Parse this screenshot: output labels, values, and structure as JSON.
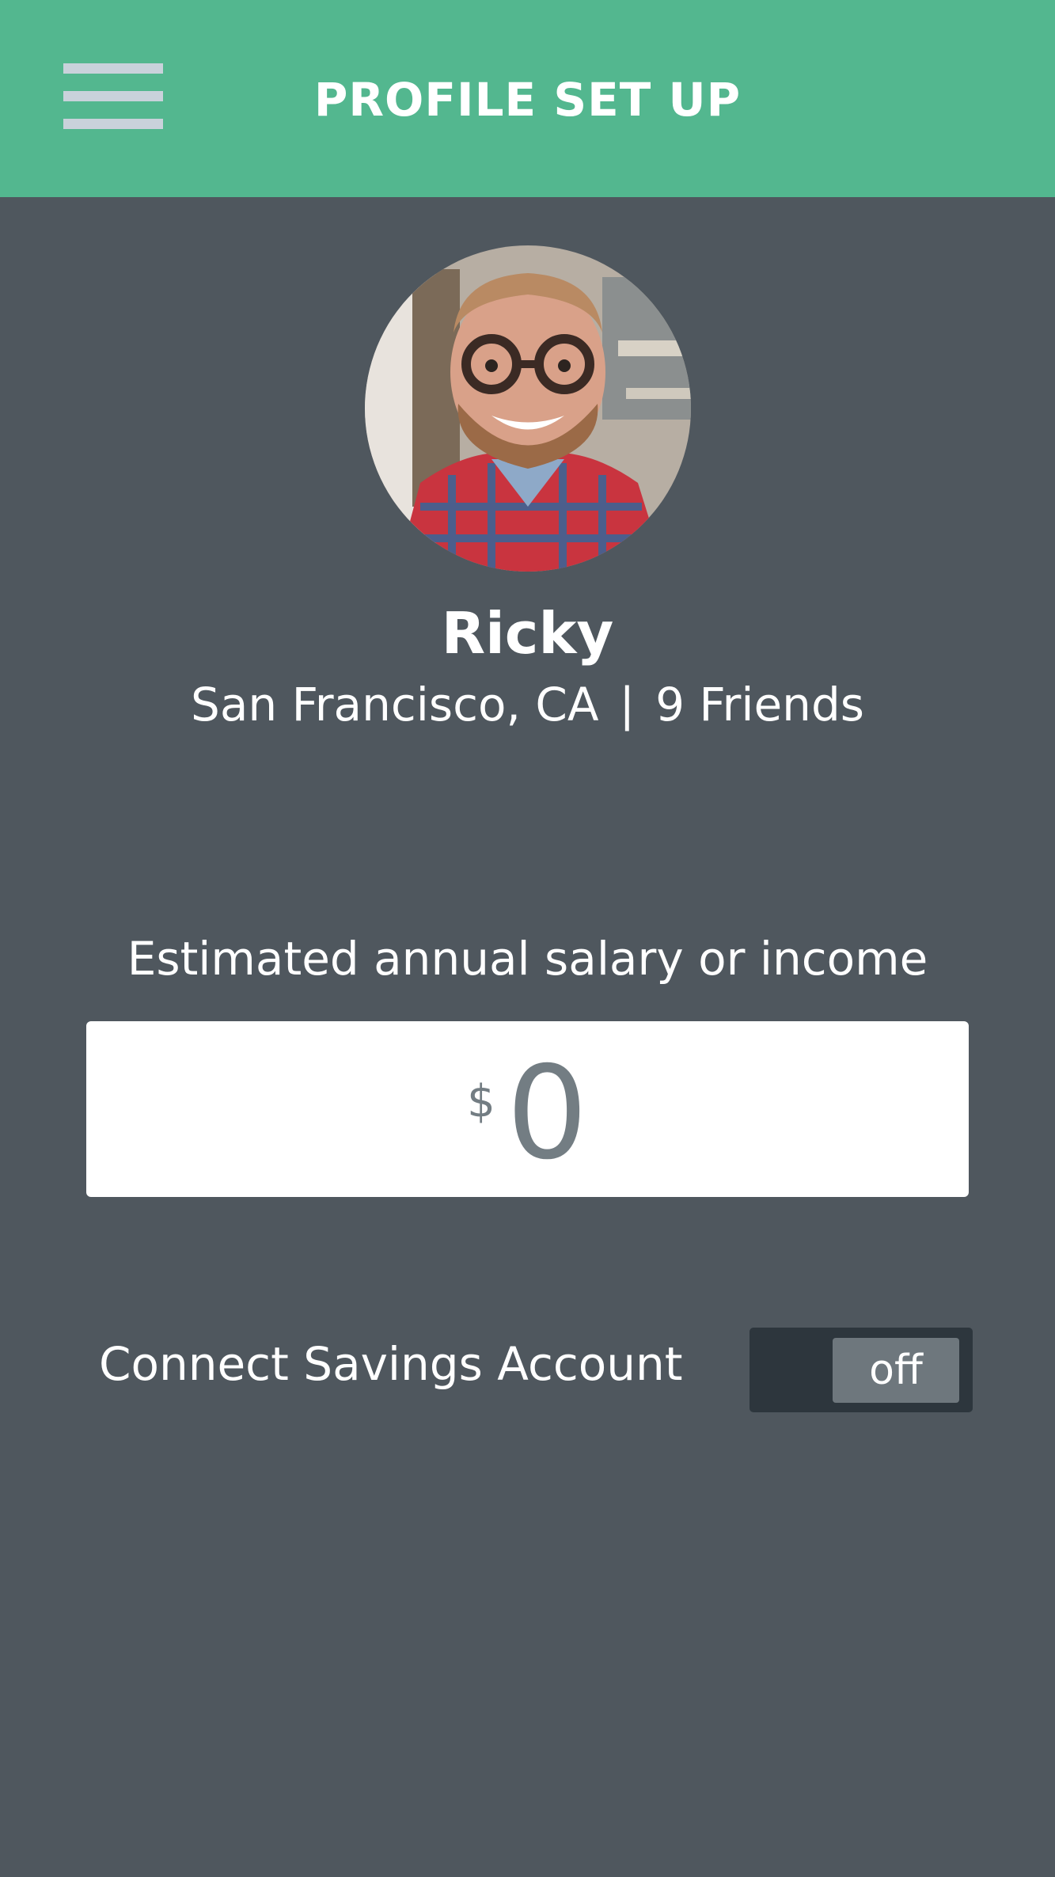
{
  "header": {
    "title": "PROFILE SET UP",
    "menu_icon": "hamburger-menu-icon",
    "background_color": "#53b78f"
  },
  "profile": {
    "name": "Ricky",
    "location": "San Francisco, CA",
    "separator": "|",
    "friends": "9 Friends",
    "avatar": "profile-photo"
  },
  "income": {
    "label": "Estimated annual salary or income",
    "currency_symbol": "$",
    "value": "0"
  },
  "savings": {
    "label": "Connect Savings Account",
    "toggle_state": "off"
  },
  "colors": {
    "background": "#4f575e",
    "accent": "#53b78f",
    "toggle_track": "#2d363d",
    "toggle_knob": "#6e777d"
  }
}
